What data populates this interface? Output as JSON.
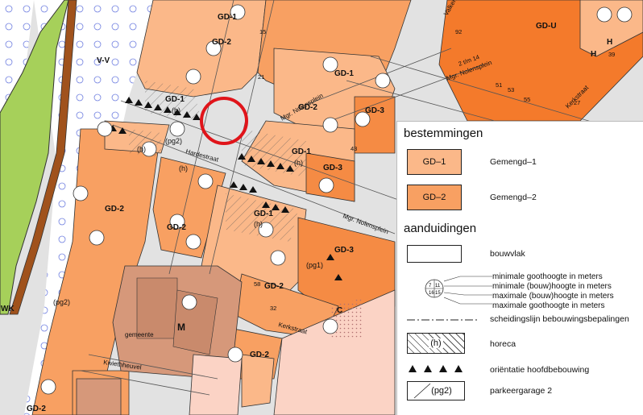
{
  "map": {
    "zones": [
      {
        "label": "GD-1"
      },
      {
        "label": "GD-2"
      },
      {
        "label": "GD-1"
      },
      {
        "label": "GD-3"
      },
      {
        "label": "GD-1"
      },
      {
        "label": "GD-2"
      },
      {
        "label": "GD-1"
      },
      {
        "label": "GD-3"
      },
      {
        "label": "GD-2"
      },
      {
        "label": "GD-1"
      },
      {
        "label": "GD-3"
      },
      {
        "label": "GD-2"
      },
      {
        "label": "GD-2"
      },
      {
        "label": "GD-2"
      },
      {
        "label": "GD-U"
      },
      {
        "label": "GD-2"
      },
      {
        "label": "V-V"
      },
      {
        "label": "M"
      },
      {
        "label": "C"
      },
      {
        "label": "H"
      },
      {
        "label": "H"
      },
      {
        "label": "WK"
      }
    ],
    "annotations": [
      {
        "text": "(h)"
      },
      {
        "text": "(h)"
      },
      {
        "text": "(h)"
      },
      {
        "text": "(h)"
      },
      {
        "text": "(h)"
      },
      {
        "text": "(pg2)"
      },
      {
        "text": "(pg2)"
      },
      {
        "text": "(pg1)"
      }
    ],
    "streets": [
      {
        "name": "Mgr. Nolensplein"
      },
      {
        "name": "Mgr. Nolensplein"
      },
      {
        "name": "Mgr. Nolensplein"
      },
      {
        "name": "Kerkstraat"
      },
      {
        "name": "Kwiethheuvel"
      },
      {
        "name": "Kerkstraat"
      },
      {
        "name": "gemeente"
      },
      {
        "name": "Valkenburg"
      },
      {
        "name": "Hardestraat"
      }
    ],
    "numbers": [
      {
        "text": "15"
      },
      {
        "text": "21"
      },
      {
        "text": "43"
      },
      {
        "text": "2 t/m 14"
      },
      {
        "text": "51"
      },
      {
        "text": "53"
      },
      {
        "text": "55"
      },
      {
        "text": "39"
      },
      {
        "text": "27"
      },
      {
        "text": "58"
      },
      {
        "text": "32"
      },
      {
        "text": "92"
      }
    ],
    "highlight": {
      "label": "marked location",
      "color": "#e0141a"
    }
  },
  "legend": {
    "section1_title": "bestemmingen",
    "gd1_code": "GD–1",
    "gd1_name": "Gemengd–1",
    "gd2_code": "GD–2",
    "gd2_name": "Gemengd–2",
    "section2_title": "aanduidingen",
    "bouwvlak": "bouwvlak",
    "height_lines": [
      "minimale goothoogte in meters",
      "minimale (bouw)hoogte in meters",
      "maximale (bouw)hoogte in meters",
      "maximale goothoogte in meters"
    ],
    "height_sample": [
      "7",
      "11",
      "16",
      "15"
    ],
    "scheidingslijn": "scheidingslijn bebouwingsbepalingen",
    "horeca_code": "(h)",
    "horeca": "horeca",
    "orientatie": "oriëntatie hoofdbebouwing",
    "pg2_code": "(pg2)",
    "parkeergarage": "parkeergarage 2"
  },
  "colors": {
    "gd1": "#fbb889",
    "gd2": "#f8a062",
    "gd3": "#f58b44",
    "gdu": "#f47a2b",
    "maatschappelijk": "#d6987a",
    "groen": "#a6d05a",
    "verkeer": "#dedede",
    "water": "#ffffff",
    "highlight": "#e0141a"
  }
}
